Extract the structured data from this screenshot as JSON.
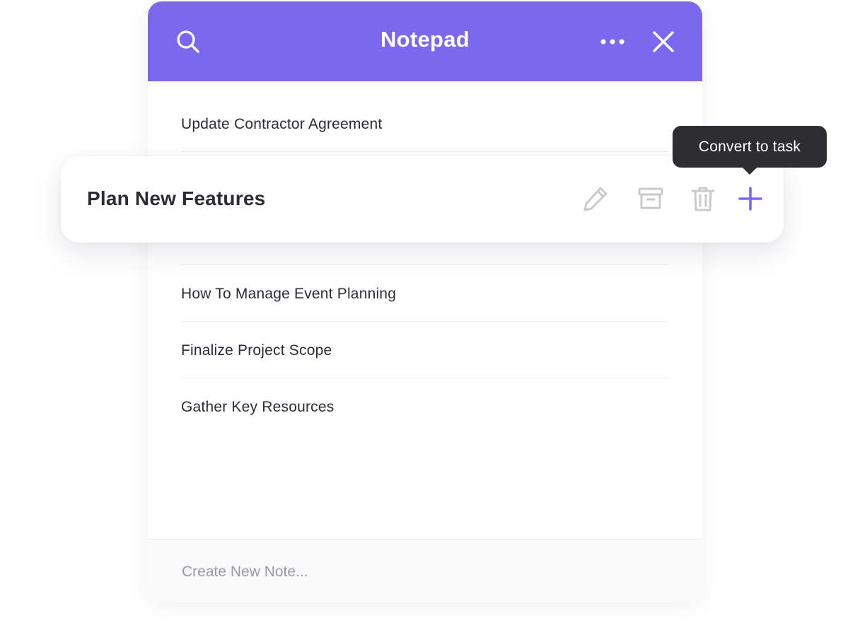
{
  "window": {
    "title": "Notepad",
    "accent_color": "#7b68ee",
    "icons": {
      "search": "search-icon",
      "more": "more-horizontal-icon",
      "close": "close-icon"
    }
  },
  "notes": [
    {
      "title": "Update Contractor Agreement"
    },
    {
      "title": "How To Manage Event Planning"
    },
    {
      "title": "Finalize Project Scope"
    },
    {
      "title": "Gather Key Resources"
    }
  ],
  "selected_note": {
    "title": "Plan New Features",
    "actions": [
      {
        "name": "edit",
        "icon": "pencil-icon",
        "color": "#c9c9cf"
      },
      {
        "name": "archive",
        "icon": "archive-box-icon",
        "color": "#c9c9cf"
      },
      {
        "name": "delete",
        "icon": "trash-icon",
        "color": "#c9c9cf"
      },
      {
        "name": "convert",
        "icon": "plus-icon",
        "color": "#7b68ee"
      }
    ]
  },
  "tooltip": {
    "text": "Convert to task"
  },
  "new_note": {
    "placeholder": "Create New Note..."
  }
}
